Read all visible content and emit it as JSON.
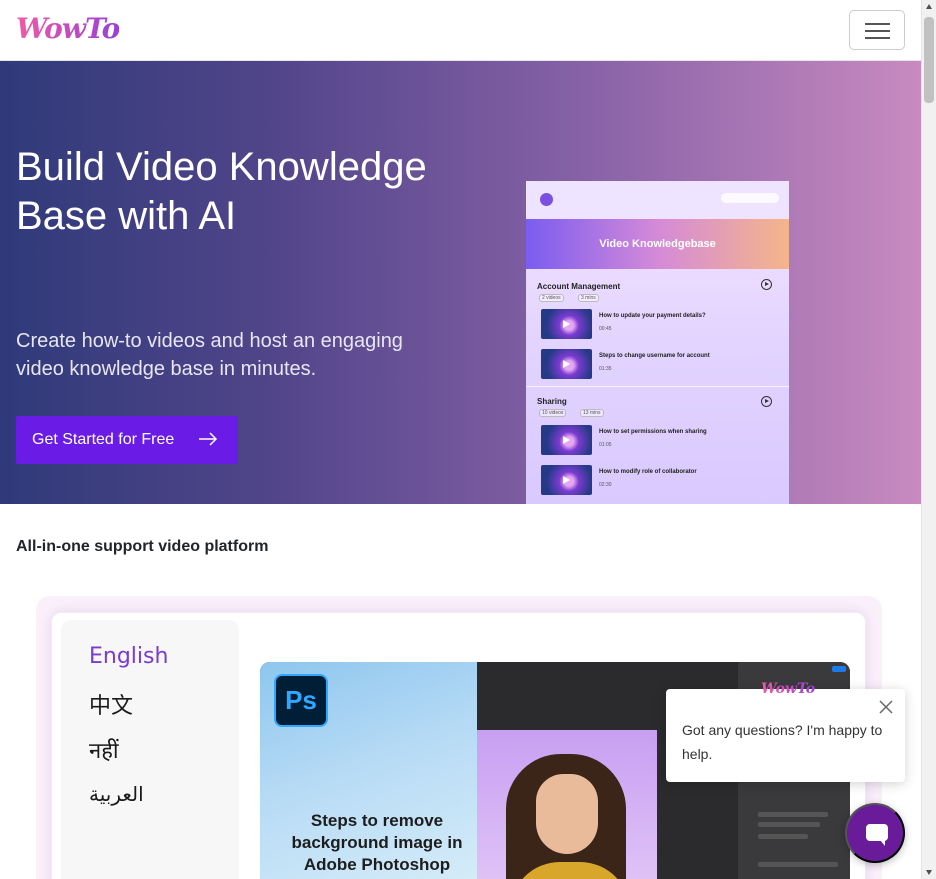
{
  "brand": {
    "logo_text": "WowTo"
  },
  "navbar": {
    "menu_toggle_label": "Toggle navigation"
  },
  "hero": {
    "title": "Build Video Knowledge Base with AI",
    "subtitle": "Create how-to videos and host an engaging video knowledge base in minutes.",
    "cta_label": "Get Started for Free"
  },
  "kb_preview": {
    "banner_title": "Video Knowledgebase",
    "sections": [
      {
        "title": "Account Management",
        "videos_count": "2 videos",
        "duration": "3 mins",
        "items": [
          {
            "title": "How to update your payment details?",
            "time": "00:45"
          },
          {
            "title": "Steps to change username for account",
            "time": "01:35"
          }
        ]
      },
      {
        "title": "Sharing",
        "videos_count": "10 videos",
        "duration": "13 mins",
        "items": [
          {
            "title": "How to set permissions when sharing",
            "time": "01:05"
          },
          {
            "title": "How to modify role of collaborator",
            "time": "02:30"
          }
        ]
      }
    ]
  },
  "platform": {
    "section_title": "All-in-one support video platform",
    "languages": [
      "English",
      "中文",
      "नहीं",
      "العربية"
    ],
    "active_language": "English",
    "video": {
      "app_badge": "Ps",
      "caption": "Steps to remove background image in Adobe Photoshop"
    }
  },
  "chat": {
    "logo_text": "WowTo",
    "message": "Got any questions? I'm happy to help."
  },
  "colors": {
    "accent": "#6a1be6",
    "chat_button": "#6a1b9a",
    "hero_gradient_start": "#2f3a7a",
    "hero_gradient_end": "#c88ac0"
  }
}
